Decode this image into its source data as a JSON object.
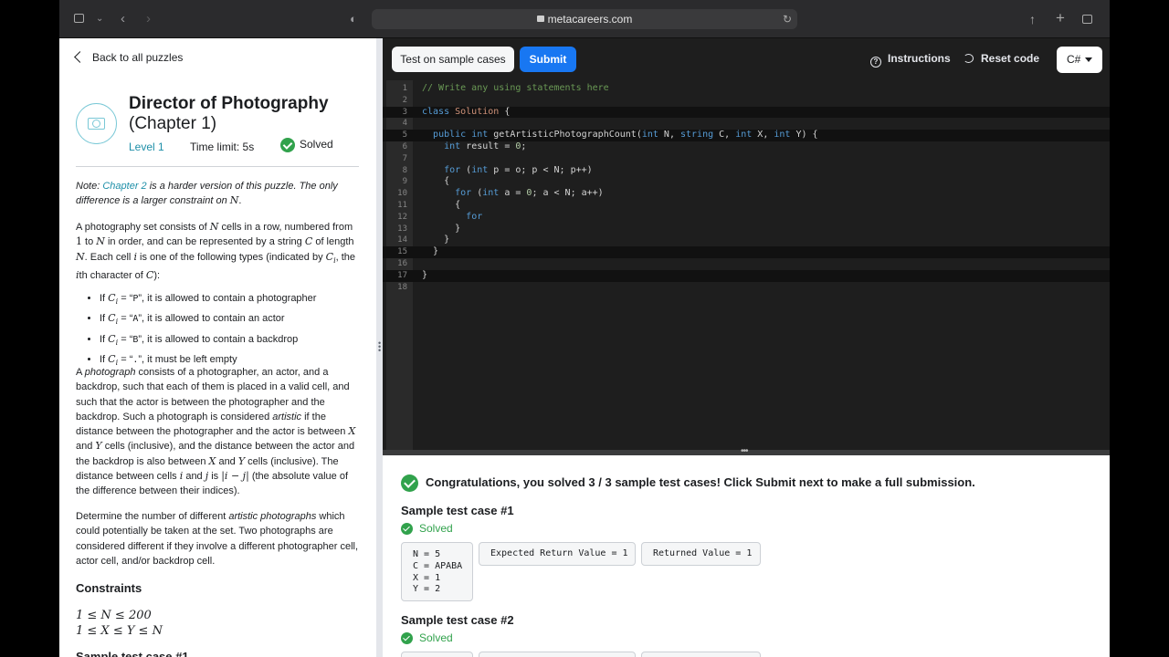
{
  "browser": {
    "url": "metacareers.com",
    "icons": [
      "sidebar-icon",
      "chevron-down-icon",
      "back-icon",
      "forward-icon",
      "shield-icon",
      "lock-icon",
      "reload-icon",
      "share-icon",
      "new-tab-icon",
      "tabs-icon"
    ]
  },
  "problem": {
    "back_label": "Back to all puzzles",
    "title": "Director of Photography",
    "chapter": "(Chapter 1)",
    "level": "Level 1",
    "time_limit": "Time limit: 5s",
    "status": "Solved",
    "note_prefix": "Note: ",
    "note_link": "Chapter 2",
    "note_rest": " is a harder version of this puzzle. The only difference is a larger constraint on ",
    "note_var": "N",
    "note_end": ".",
    "bullets": [
      {
        "pre": "If ",
        "var": "C",
        "sub": "i",
        "mid": " = “",
        "code": "P",
        "post": "”, it is allowed to contain a photographer"
      },
      {
        "pre": "If ",
        "var": "C",
        "sub": "i",
        "mid": " = “",
        "code": "A",
        "post": "”, it is allowed to contain an actor"
      },
      {
        "pre": "If ",
        "var": "C",
        "sub": "i",
        "mid": " = “",
        "code": "B",
        "post": "”, it is allowed to contain a backdrop"
      },
      {
        "pre": "If ",
        "var": "C",
        "sub": "i",
        "mid": " = “",
        "code": ".",
        "post": "”, it must be left empty"
      }
    ],
    "p3_a": "A ",
    "p3_em1": "photograph",
    "p3_b": " consists of a photographer, an actor, and a backdrop, such that each of them is placed in a valid cell, and such that the actor is between the photographer and the backdrop. Such a photograph is considered ",
    "p3_em2": "artistic",
    "p3_c": " if the distance between the photographer and the actor is between ",
    "p3_d": " and ",
    "p3_e": " cells (inclusive), and the distance between the actor and the backdrop is also between ",
    "p3_f": " cells (inclusive). The distance between cells ",
    "p3_g": " is ",
    "p3_h": " (the absolute value of the difference between their indices).",
    "p4_a": "Determine the number of different ",
    "p4_em": "artistic photographs",
    "p4_b": " which could potentially be taken at the set. Two photographs are considered different if they involve a different photographer cell, actor cell, and/or backdrop cell.",
    "constraints_heading": "Constraints",
    "constraint1": "1 ≤ N ≤ 200",
    "constraint2": "1 ≤ X ≤ Y ≤ N",
    "sample_heading": "Sample test case #1"
  },
  "toolbar": {
    "test_label": "Test on sample cases",
    "submit_label": "Submit",
    "instructions_label": "Instructions",
    "reset_label": "Reset code",
    "language": "C#"
  },
  "editor": {
    "lines": [
      {
        "n": "1",
        "tokens": [
          {
            "c": "cm",
            "t": "// Write any using statements here"
          }
        ]
      },
      {
        "n": "2",
        "tokens": []
      },
      {
        "n": "3",
        "hl": true,
        "tokens": [
          {
            "c": "kw",
            "t": "class "
          },
          {
            "c": "cl",
            "t": "Solution"
          },
          {
            "c": "",
            "t": " {"
          }
        ]
      },
      {
        "n": "4",
        "tokens": []
      },
      {
        "n": "5",
        "hl": true,
        "tokens": [
          {
            "c": "",
            "t": "  "
          },
          {
            "c": "kw",
            "t": "public int"
          },
          {
            "c": "",
            "t": " getArtisticPhotographCount("
          },
          {
            "c": "kw",
            "t": "int"
          },
          {
            "c": "",
            "t": " N, "
          },
          {
            "c": "kw",
            "t": "string"
          },
          {
            "c": "",
            "t": " C, "
          },
          {
            "c": "kw",
            "t": "int"
          },
          {
            "c": "",
            "t": " X, "
          },
          {
            "c": "kw",
            "t": "int"
          },
          {
            "c": "",
            "t": " Y) {"
          }
        ]
      },
      {
        "n": "6",
        "tokens": [
          {
            "c": "",
            "t": "    "
          },
          {
            "c": "kw",
            "t": "int"
          },
          {
            "c": "",
            "t": " result = "
          },
          {
            "c": "num",
            "t": "0"
          },
          {
            "c": "",
            "t": ";"
          }
        ]
      },
      {
        "n": "7",
        "tokens": []
      },
      {
        "n": "8",
        "tokens": [
          {
            "c": "",
            "t": "    "
          },
          {
            "c": "kw",
            "t": "for"
          },
          {
            "c": "",
            "t": " ("
          },
          {
            "c": "kw",
            "t": "int"
          },
          {
            "c": "",
            "t": " p = o; p < N; p++)"
          }
        ]
      },
      {
        "n": "9",
        "tokens": [
          {
            "c": "",
            "t": "    {"
          }
        ]
      },
      {
        "n": "10",
        "tokens": [
          {
            "c": "",
            "t": "      "
          },
          {
            "c": "kw",
            "t": "for"
          },
          {
            "c": "",
            "t": " ("
          },
          {
            "c": "kw",
            "t": "int"
          },
          {
            "c": "",
            "t": " a = "
          },
          {
            "c": "num",
            "t": "0"
          },
          {
            "c": "",
            "t": "; a < N; a++)"
          }
        ]
      },
      {
        "n": "11",
        "tokens": [
          {
            "c": "",
            "t": "      {"
          }
        ]
      },
      {
        "n": "12",
        "tokens": [
          {
            "c": "",
            "t": "        "
          },
          {
            "c": "kw",
            "t": "for"
          }
        ]
      },
      {
        "n": "13",
        "tokens": [
          {
            "c": "",
            "t": "      }"
          }
        ]
      },
      {
        "n": "14",
        "tokens": [
          {
            "c": "",
            "t": "    }"
          }
        ]
      },
      {
        "n": "15",
        "hl": true,
        "tokens": [
          {
            "c": "",
            "t": "  }"
          }
        ]
      },
      {
        "n": "16",
        "tokens": []
      },
      {
        "n": "17",
        "hl": true,
        "tokens": [
          {
            "c": "",
            "t": "}"
          }
        ]
      },
      {
        "n": "18",
        "tokens": []
      }
    ]
  },
  "results": {
    "congrats": "Congratulations, you solved 3 / 3 sample test cases! Click Submit next to make a full submission.",
    "case1_title": "Sample test case #1",
    "case1_status": "Solved",
    "case1_input": "N = 5\nC = APABA\nX = 1\nY = 2",
    "case1_expected": "Expected Return Value = 1",
    "case1_returned": "Returned Value = 1",
    "case2_title": "Sample test case #2",
    "case2_status": "Solved"
  },
  "colors": {
    "accent": "#1877f2",
    "success": "#31a24c",
    "link": "#1e8fa8"
  }
}
